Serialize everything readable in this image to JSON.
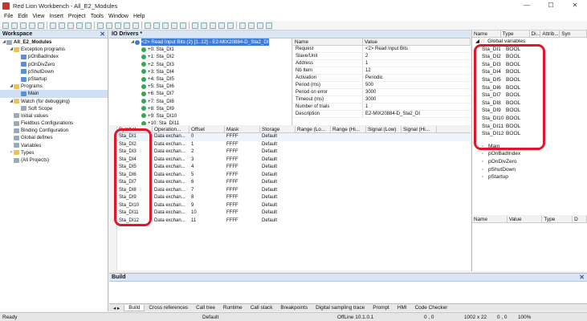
{
  "window": {
    "title": "Red Lion Workbench - All_E2_Modules",
    "controls": [
      "—",
      "☐",
      "✕"
    ]
  },
  "menu": [
    "File",
    "Edit",
    "View",
    "Insert",
    "Project",
    "Tools",
    "Window",
    "Help"
  ],
  "workspace": {
    "header": "Workspace",
    "tree": [
      {
        "label": "All_E2_Modules",
        "level": 0,
        "arrow": "◢",
        "icon": "doc",
        "bold": true
      },
      {
        "label": "Exception programs",
        "level": 1,
        "arrow": "◢",
        "icon": "folder"
      },
      {
        "label": "pOnBadIndex",
        "level": 2,
        "arrow": "",
        "icon": "prog"
      },
      {
        "label": "pOnDivZero",
        "level": 2,
        "arrow": "",
        "icon": "prog"
      },
      {
        "label": "pShutDown",
        "level": 2,
        "arrow": "",
        "icon": "prog"
      },
      {
        "label": "pStartup",
        "level": 2,
        "arrow": "",
        "icon": "prog"
      },
      {
        "label": "Programs",
        "level": 1,
        "arrow": "◢",
        "icon": "folder"
      },
      {
        "label": "Main",
        "level": 2,
        "arrow": "",
        "icon": "prog",
        "selected": true
      },
      {
        "label": "Watch (for debugging)",
        "level": 1,
        "arrow": "◢",
        "icon": "folder"
      },
      {
        "label": "Soft Scope",
        "level": 2,
        "arrow": "",
        "icon": "doc"
      },
      {
        "label": "Initial values",
        "level": 1,
        "arrow": "",
        "icon": "doc"
      },
      {
        "label": "Fieldbus Configurations",
        "level": 1,
        "arrow": "",
        "icon": "doc"
      },
      {
        "label": "Binding Configuration",
        "level": 1,
        "arrow": "",
        "icon": "doc"
      },
      {
        "label": "Global defines",
        "level": 1,
        "arrow": "",
        "icon": "doc"
      },
      {
        "label": "Variables",
        "level": 1,
        "arrow": "",
        "icon": "doc"
      },
      {
        "label": "Types",
        "level": 1,
        "arrow": ">",
        "icon": "folder"
      },
      {
        "label": "(All Projects)",
        "level": 1,
        "arrow": "",
        "icon": "doc"
      }
    ]
  },
  "io_drivers": {
    "header": "IO Drivers *",
    "tree": [
      {
        "label": "<2> Read Input Bits (2) [1..12] - E2-MIX20884-D_Sta2_DI",
        "selected": true
      },
      {
        "label": "+0: Sta_DI1"
      },
      {
        "label": "+1: Sta_DI2"
      },
      {
        "label": "+2: Sta_DI3"
      },
      {
        "label": "+3: Sta_DI4"
      },
      {
        "label": "+4: Sta_DI5"
      },
      {
        "label": "+5: Sta_DI6"
      },
      {
        "label": "+6: Sta_DI7"
      },
      {
        "label": "+7: Sta_DI8"
      },
      {
        "label": "+8: Sta_DI9"
      },
      {
        "label": "+9: Sta_DI10"
      },
      {
        "label": "+10: Sta_DI11"
      }
    ],
    "properties": {
      "col_name": "Name",
      "col_value": "Value",
      "rows": [
        {
          "name": "Request",
          "value": "<2> Read Input Bits"
        },
        {
          "name": "Slave/Unit",
          "value": "2"
        },
        {
          "name": "Address",
          "value": "1"
        },
        {
          "name": "Nb Item",
          "value": "12"
        },
        {
          "name": "Activation",
          "value": "Periodic"
        },
        {
          "name": "Period (ms)",
          "value": "500"
        },
        {
          "name": "Period on error",
          "value": "3000"
        },
        {
          "name": "Timeout (ms)",
          "value": "3000"
        },
        {
          "name": "Number of trials",
          "value": "1"
        },
        {
          "name": "Description",
          "value": "E2-MIX20884-D_Sta2_DI"
        }
      ]
    }
  },
  "symbols": {
    "columns": [
      "Symbol",
      "Operation...",
      "Offset",
      "Mask",
      "Storage",
      "Range (Lo...",
      "Range (Hi...",
      "Signal (Low)",
      "Signal (Hi..."
    ],
    "rows": [
      [
        "Sta_DI1",
        "Data exchan...",
        "0",
        "FFFF",
        "Default"
      ],
      [
        "Sta_DI2",
        "Data exchan...",
        "1",
        "FFFF",
        "Default"
      ],
      [
        "Sta_DI3",
        "Data exchan...",
        "2",
        "FFFF",
        "Default"
      ],
      [
        "Sta_DI4",
        "Data exchan...",
        "3",
        "FFFF",
        "Default"
      ],
      [
        "Sta_DI5",
        "Data exchan...",
        "4",
        "FFFF",
        "Default"
      ],
      [
        "Sta_DI6",
        "Data exchan...",
        "5",
        "FFFF",
        "Default"
      ],
      [
        "Sta_DI7",
        "Data exchan...",
        "6",
        "FFFF",
        "Default"
      ],
      [
        "Sta_DI8",
        "Data exchan...",
        "7",
        "FFFF",
        "Default"
      ],
      [
        "Sta_DI9",
        "Data exchan...",
        "8",
        "FFFF",
        "Default"
      ],
      [
        "Sta_DI10",
        "Data exchan...",
        "9",
        "FFFF",
        "Default"
      ],
      [
        "Sta_DI11",
        "Data exchan...",
        "10",
        "FFFF",
        "Default"
      ],
      [
        "Sta_DI12",
        "Data exchan...",
        "11",
        "FFFF",
        "Default"
      ]
    ]
  },
  "variables_panel": {
    "columns": [
      "Name",
      "Type",
      "Di...",
      "Attrib...",
      "Syn"
    ],
    "group": "Global variables",
    "rows": [
      {
        "name": "Sta_DI1",
        "type": "BOOL"
      },
      {
        "name": "Sta_DI2",
        "type": "BOOL"
      },
      {
        "name": "Sta_DI3",
        "type": "BOOL"
      },
      {
        "name": "Sta_DI4",
        "type": "BOOL"
      },
      {
        "name": "Sta_DI5",
        "type": "BOOL"
      },
      {
        "name": "Sta_DI6",
        "type": "BOOL"
      },
      {
        "name": "Sta_DI7",
        "type": "BOOL"
      },
      {
        "name": "Sta_DI8",
        "type": "BOOL"
      },
      {
        "name": "Sta_DI9",
        "type": "BOOL"
      },
      {
        "name": "Sta_DI10",
        "type": "BOOL"
      },
      {
        "name": "Sta_DI11",
        "type": "BOOL"
      },
      {
        "name": "Sta_DI12",
        "type": "BOOL"
      }
    ],
    "programs": [
      "Main",
      "pOnBadIndex",
      "pOnDivZero",
      "pShutDown",
      "pStartup"
    ]
  },
  "watch_panel": {
    "columns": [
      "Name",
      "Value",
      "Type",
      "D"
    ]
  },
  "build": {
    "header": "Build",
    "tabs": [
      "Build",
      "Cross references",
      "Call tree",
      "Runtime",
      "Call stack",
      "Breakpoints",
      "Digital sampling trace",
      "Prompt",
      "HMI",
      "Code Checker"
    ],
    "active_tab": "Build"
  },
  "statusbar": {
    "ready": "Ready",
    "mode": "Default",
    "online": "OffLine  10.1.0.1",
    "coords": "0 , 0",
    "size": "1002 x 22",
    "value": "0 , 0",
    "zoom": "100%"
  },
  "colors": {
    "highlight": "#e0162b",
    "selection": "#3d7bd6",
    "panel_header": "#dbe6f4"
  }
}
